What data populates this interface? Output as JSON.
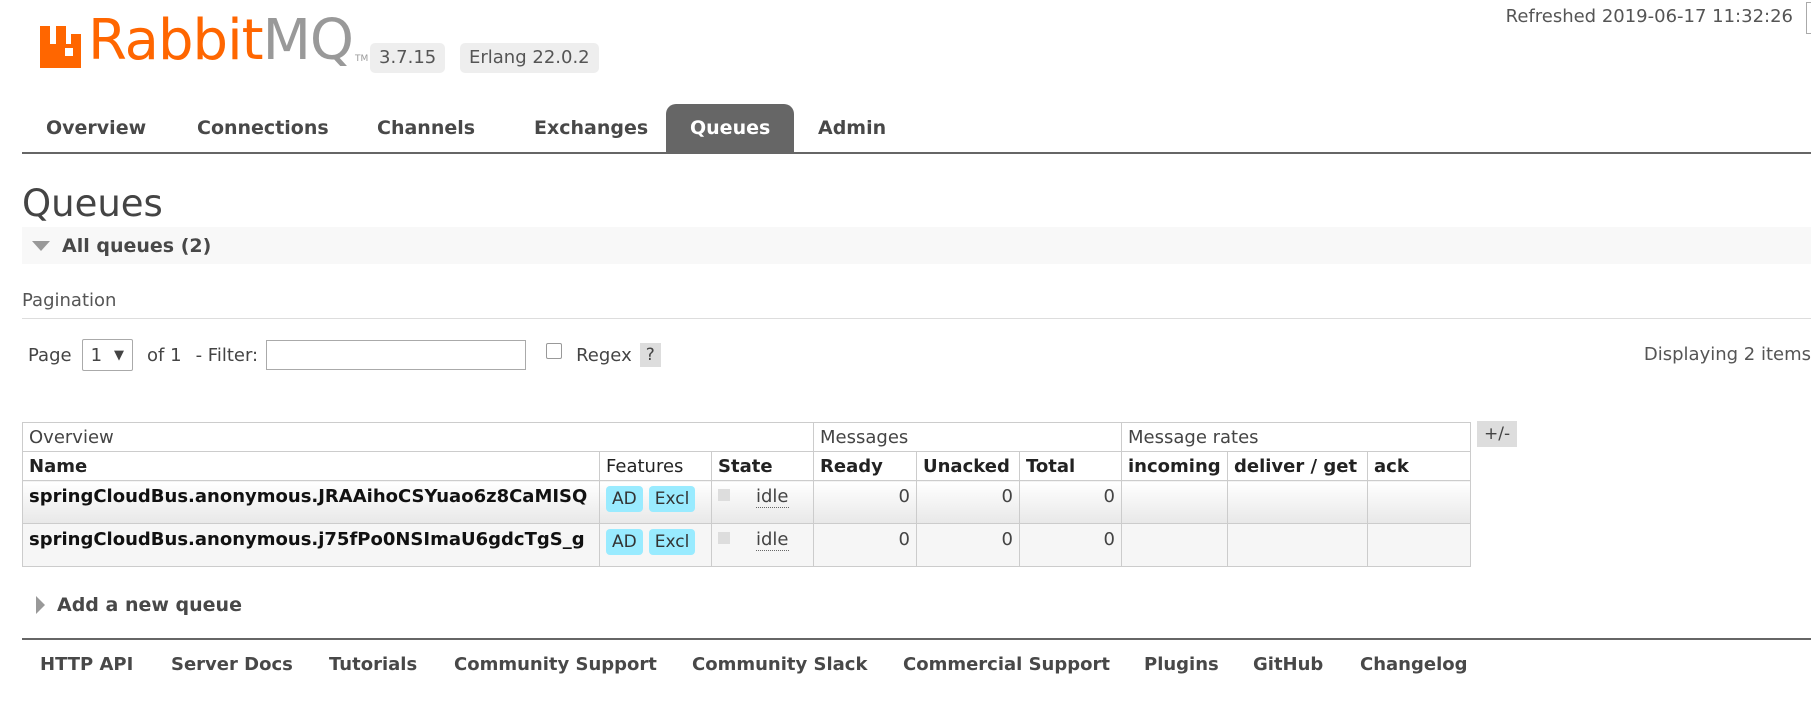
{
  "brand": {
    "rabbit": "Rabbit",
    "mq": "MQ",
    "tm": "TM",
    "accent": "#ff6600",
    "grey": "#999999"
  },
  "header": {
    "version": "3.7.15",
    "erlang": "Erlang 22.0.2",
    "refreshed": "Refreshed 2019-06-17 11:32:26"
  },
  "nav": {
    "tabs": [
      "Overview",
      "Connections",
      "Channels",
      "Exchanges",
      "Queues",
      "Admin"
    ],
    "active": "Queues"
  },
  "page": {
    "title": "Queues",
    "section": "All queues (2)"
  },
  "pagination": {
    "label": "Pagination",
    "page_label": "Page",
    "page_value": "1",
    "of_label": "of 1",
    "filter_label": "- Filter:",
    "filter_value": "",
    "regex_label": "Regex",
    "help_label": "?",
    "displaying": "Displaying 2 items"
  },
  "table": {
    "groups": {
      "overview": "Overview",
      "messages": "Messages",
      "rates": "Message rates"
    },
    "columns": {
      "name": "Name",
      "features": "Features",
      "state": "State",
      "ready": "Ready",
      "unacked": "Unacked",
      "total": "Total",
      "incoming": "incoming",
      "deliver_get": "deliver / get",
      "ack": "ack"
    },
    "toggle_label": "+/-",
    "rows": [
      {
        "name": "springCloudBus.anonymous.JRAAihoCSYuao6z8CaMISQ",
        "features": [
          "AD",
          "Excl"
        ],
        "state": "idle",
        "ready": "0",
        "unacked": "0",
        "total": "0",
        "incoming": "",
        "deliver_get": "",
        "ack": ""
      },
      {
        "name": "springCloudBus.anonymous.j75fPo0NSImaU6gdcTgS_g",
        "features": [
          "AD",
          "Excl"
        ],
        "state": "idle",
        "ready": "0",
        "unacked": "0",
        "total": "0",
        "incoming": "",
        "deliver_get": "",
        "ack": ""
      }
    ]
  },
  "add_queue": {
    "label": "Add a new queue"
  },
  "footer": {
    "links": [
      "HTTP API",
      "Server Docs",
      "Tutorials",
      "Community Support",
      "Community Slack",
      "Commercial Support",
      "Plugins",
      "GitHub",
      "Changelog"
    ]
  }
}
